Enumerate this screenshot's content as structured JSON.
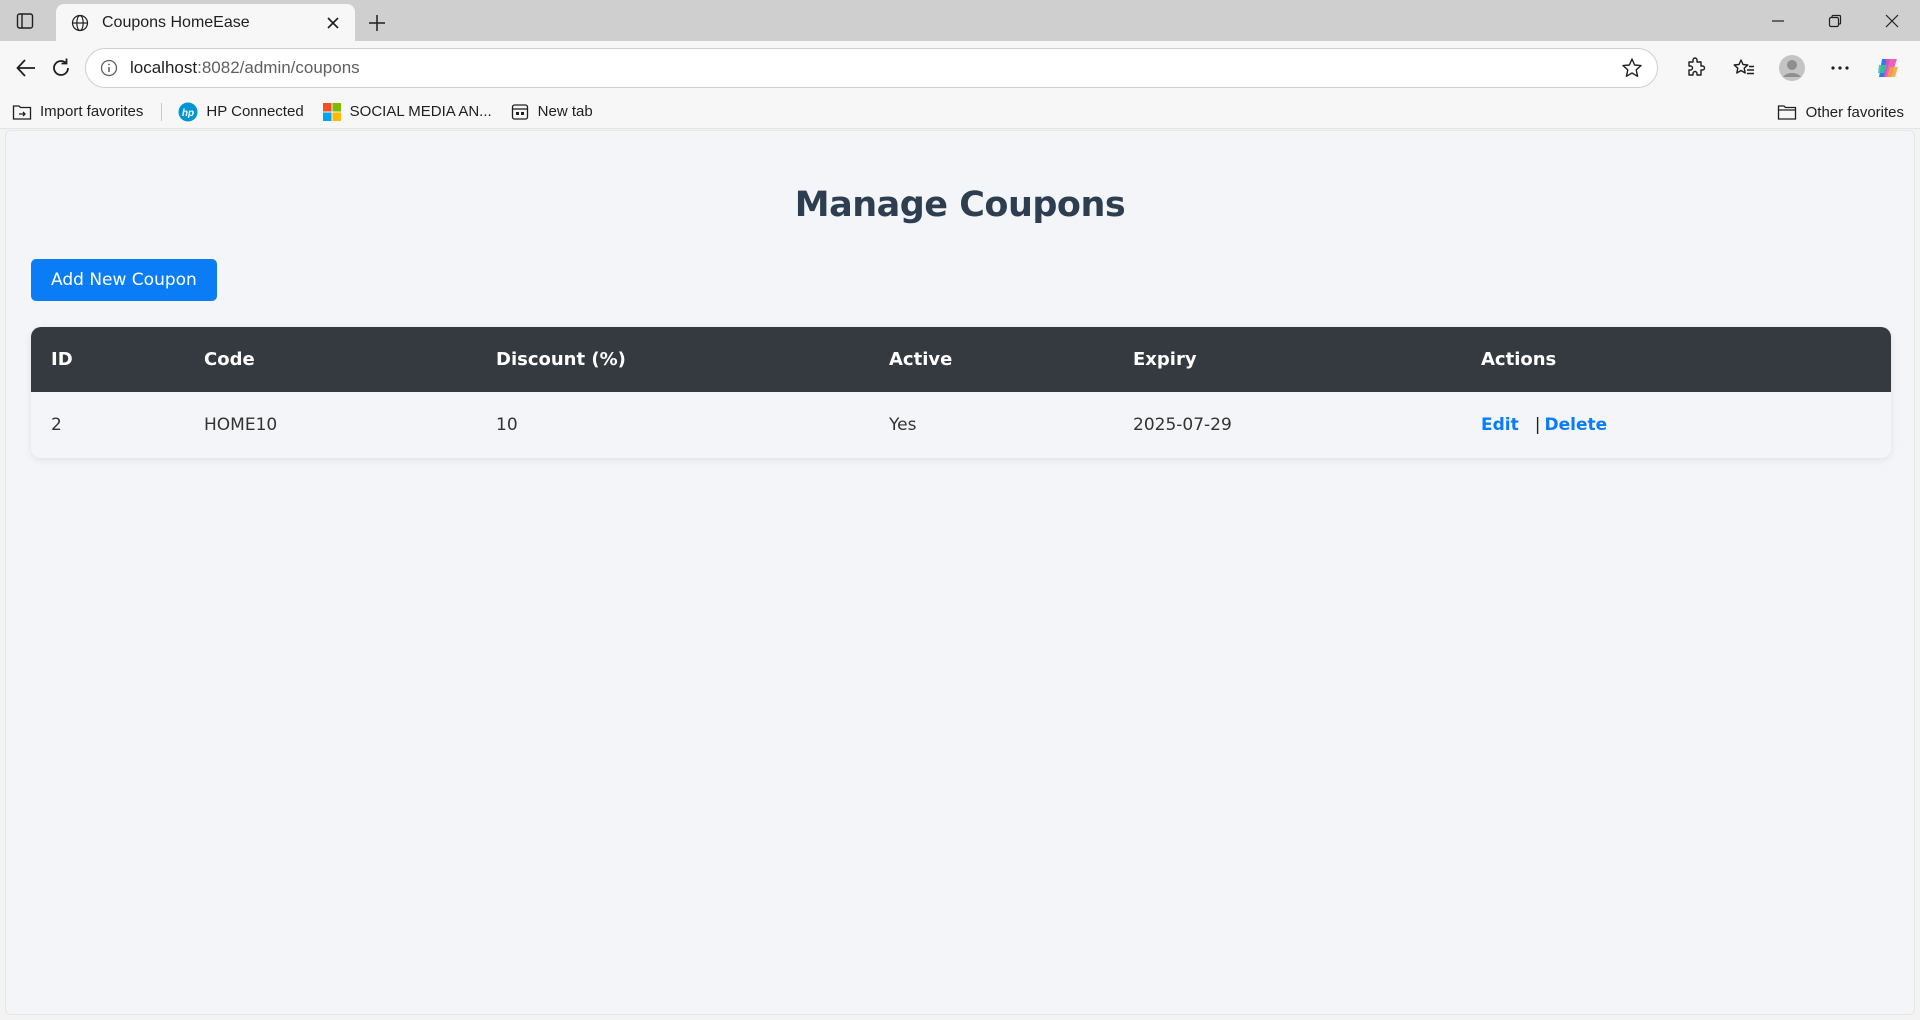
{
  "browser": {
    "tab_title": "Coupons HomeEase",
    "url_host": "localhost",
    "url_path": ":8082/admin/coupons",
    "favorites": [
      {
        "label": "Import favorites",
        "icon": "import-icon"
      },
      {
        "label": "HP Connected",
        "icon": "hp-logo-icon"
      },
      {
        "label": "SOCIAL MEDIA AN...",
        "icon": "microsoft-logo-icon"
      },
      {
        "label": "New tab",
        "icon": "newtab-page-icon"
      }
    ],
    "other_favorites": "Other favorites"
  },
  "page": {
    "title": "Manage Coupons",
    "add_button": "Add New Coupon",
    "accent_color": "#0a7cf5",
    "header_bg": "#343a40"
  },
  "table": {
    "headers": [
      "ID",
      "Code",
      "Discount (%)",
      "Active",
      "Expiry",
      "Actions"
    ],
    "rows": [
      {
        "id": "2",
        "code": "HOME10",
        "discount": "10",
        "active": "Yes",
        "expiry": "2025-07-29",
        "edit": "Edit",
        "separator": "|",
        "delete": "Delete"
      }
    ]
  }
}
